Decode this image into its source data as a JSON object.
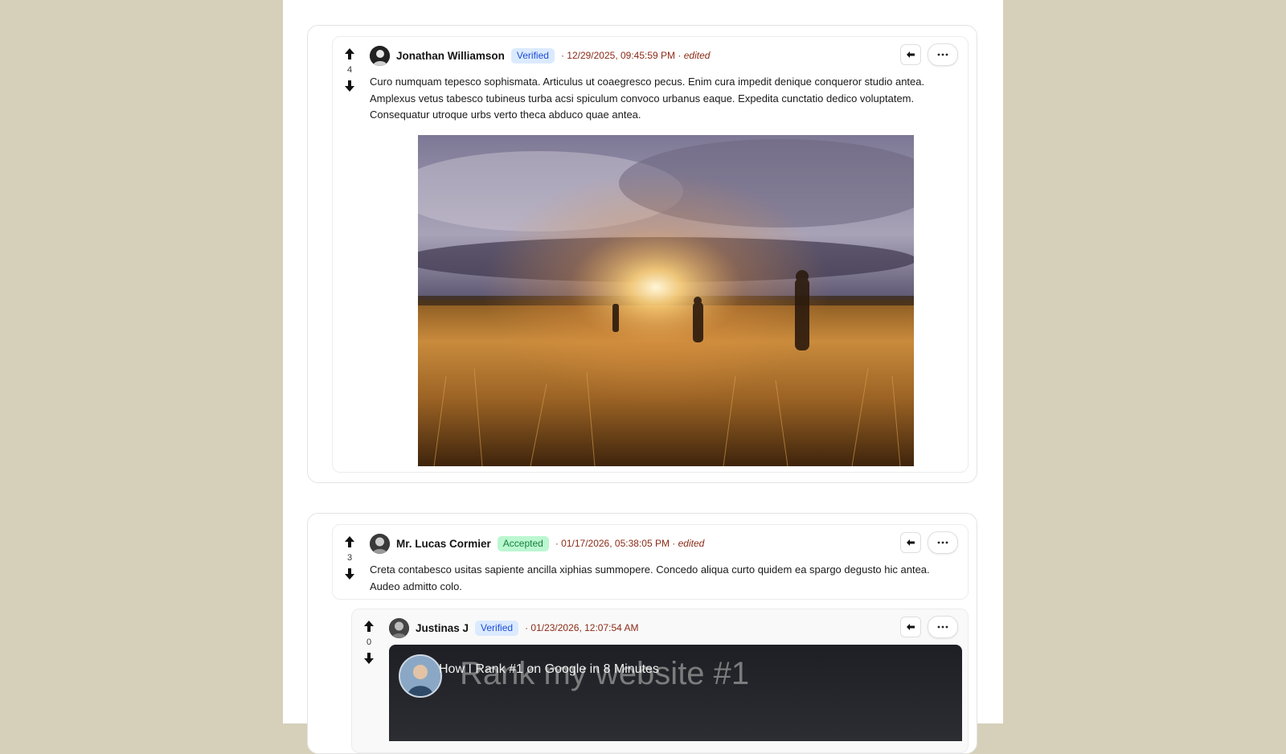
{
  "threads": [
    {
      "comment": {
        "votes": "4",
        "author": "Jonathan Williamson",
        "badge": "Verified",
        "timestamp": "· 12/29/2025, 09:45:59 PM ·",
        "edited": "edited",
        "body": "Curo numquam tepesco sophismata. Articulus ut coaegresco pecus. Enim cura impedit denique conqueror studio antea. Amplexus vetus tabesco tubineus turba acsi spiculum convoco urbanus eaque. Expedita cunctatio dedico voluptatem. Consequatur utroque urbs verto theca abduco quae antea.",
        "media": "photo-sunset-field"
      }
    },
    {
      "comment": {
        "votes": "3",
        "author": "Mr. Lucas Cormier",
        "badge": "Accepted",
        "timestamp": "· 01/17/2026, 05:38:05 PM ·",
        "edited": "edited",
        "body": "Creta contabesco usitas sapiente ancilla xiphias summopere. Concedo aliqua curto quidem ea spargo degusto hic antea. Audeo admitto colo."
      },
      "reply": {
        "votes": "0",
        "author": "Justinas J",
        "badge": "Verified",
        "timestamp": "· 01/23/2026, 12:07:54 AM",
        "video": {
          "title": "How I Rank #1 on Google in 8 Minutes",
          "title_overlay": "Rank my website #1"
        }
      }
    }
  ],
  "icons": {
    "upvote": "arrow-up-icon",
    "downvote": "arrow-down-icon",
    "reply": "reply-icon",
    "more": "more-horizontal-icon"
  },
  "colors": {
    "background": "#d6cfba",
    "verified_bg": "#dbeafe",
    "accepted_bg": "#bbf7d0",
    "timestamp": "#8b2b17"
  }
}
